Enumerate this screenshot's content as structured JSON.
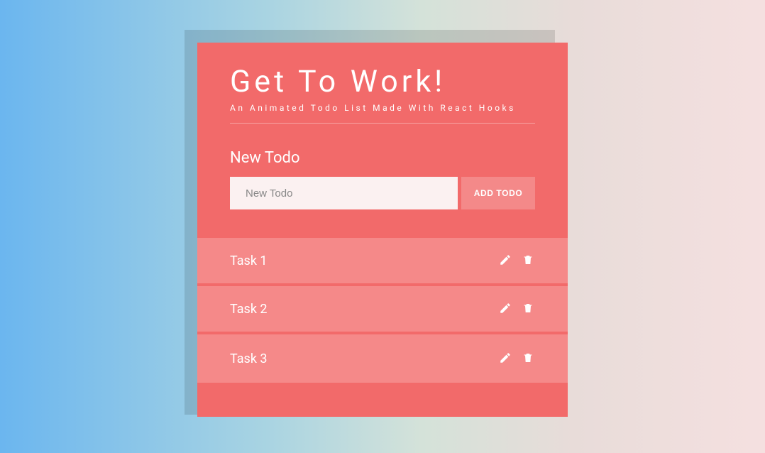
{
  "header": {
    "title": "Get To Work!",
    "subtitle": "An Animated Todo List Made With React Hooks"
  },
  "form": {
    "section_label": "New Todo",
    "input_placeholder": "New Todo",
    "input_value": "",
    "add_button_label": "ADD TODO"
  },
  "tasks": [
    {
      "label": "Task 1"
    },
    {
      "label": "Task 2"
    },
    {
      "label": "Task 3"
    }
  ],
  "icons": {
    "edit": "pencil-icon",
    "delete": "trash-icon"
  }
}
